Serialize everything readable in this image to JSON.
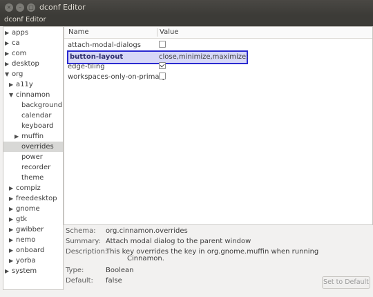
{
  "window": {
    "title": "dconf Editor",
    "menubar_title": "dconf Editor",
    "buttons": {
      "close": "×",
      "minimize": "–",
      "maximize": "□"
    }
  },
  "tree": {
    "items": [
      {
        "label": "apps",
        "arrow": "▶"
      },
      {
        "label": "ca",
        "arrow": "▶"
      },
      {
        "label": "com",
        "arrow": "▶"
      },
      {
        "label": "desktop",
        "arrow": "▶"
      },
      {
        "label": "org",
        "arrow": "▼"
      },
      {
        "label": "a11y",
        "arrow": "▶"
      },
      {
        "label": "cinnamon",
        "arrow": "▼"
      },
      {
        "label": "background",
        "arrow": ""
      },
      {
        "label": "calendar",
        "arrow": ""
      },
      {
        "label": "keyboard",
        "arrow": ""
      },
      {
        "label": "muffin",
        "arrow": "▶"
      },
      {
        "label": "overrides",
        "arrow": ""
      },
      {
        "label": "power",
        "arrow": ""
      },
      {
        "label": "recorder",
        "arrow": ""
      },
      {
        "label": "theme",
        "arrow": ""
      },
      {
        "label": "compiz",
        "arrow": "▶"
      },
      {
        "label": "freedesktop",
        "arrow": "▶"
      },
      {
        "label": "gnome",
        "arrow": "▶"
      },
      {
        "label": "gtk",
        "arrow": "▶"
      },
      {
        "label": "gwibber",
        "arrow": "▶"
      },
      {
        "label": "nemo",
        "arrow": "▶"
      },
      {
        "label": "onboard",
        "arrow": "▶"
      },
      {
        "label": "yorba",
        "arrow": "▶"
      },
      {
        "label": "system",
        "arrow": "▶"
      }
    ]
  },
  "keys": {
    "header": {
      "name": "Name",
      "value": "Value"
    },
    "rows": [
      {
        "name": "attach-modal-dialogs",
        "checked": false
      },
      {
        "name": "button-layout",
        "value": "close,minimize,maximize:"
      },
      {
        "name": "edge-tiling",
        "checked": true
      },
      {
        "name": "workspaces-only-on-primary",
        "checked": false
      }
    ]
  },
  "info": {
    "schema_label": "Schema:",
    "schema": "org.cinnamon.overrides",
    "summary_label": "Summary:",
    "summary": "Attach modal dialog to the parent window",
    "description_label": "Description:",
    "description": "This key overrides the key in org.gnome.muffin when running",
    "description_cont": "Cinnamon.",
    "type_label": "Type:",
    "type": "Boolean",
    "default_label": "Default:",
    "default": "false",
    "set_default_label": "Set to Default"
  }
}
